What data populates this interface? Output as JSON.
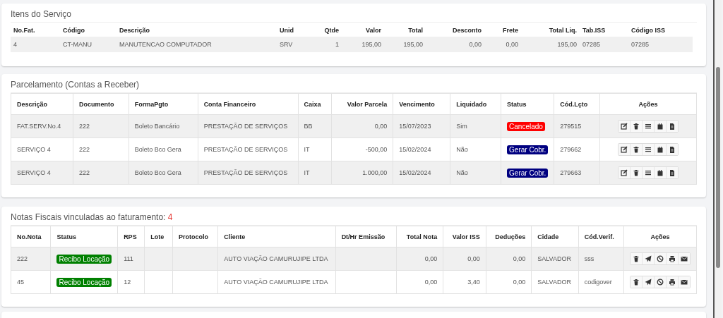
{
  "items_section": {
    "title": "Itens do Serviço",
    "columns": [
      "No.Fat.",
      "Código",
      "Descrição",
      "Unid",
      "Qtde",
      "Valor",
      "Total",
      "Desconto",
      "Frete",
      "Total Liq.",
      "Tab.ISS",
      "Código ISS"
    ],
    "rows": [
      [
        "4",
        "CT-MANU",
        "MANUTENCAO COMPUTADOR",
        "SRV",
        "1",
        "195,00",
        "195,00",
        "0,00",
        "0,00",
        "195,00",
        "07285",
        "07285"
      ]
    ]
  },
  "installments": {
    "title": "Parcelamento (Contas a Receber)",
    "columns": [
      "Descrição",
      "Documento",
      "FormaPgto",
      "Conta Financeiro",
      "Caixa",
      "Valor Parcela",
      "Vencimento",
      "Liquidado",
      "Status",
      "Cód.Lçto",
      "Ações"
    ],
    "rows": [
      [
        "FAT.SERV.No.4",
        "222",
        "Boleto Bancário",
        "PRESTAÇÃO DE SERVIÇOS",
        "BB",
        "0,00",
        "15/07/2023",
        "Sim",
        {
          "label": "Cancelado",
          "color": "#ff0000"
        },
        "279515"
      ],
      [
        "SERVIÇO 4",
        "222",
        "Boleto Bco Gera",
        "PRESTAÇÃO DE SERVIÇOS",
        "IT",
        "-500,00",
        "15/02/2024",
        "Não",
        {
          "label": "Gerar Cobr.",
          "color": "#000080"
        },
        "279662"
      ],
      [
        "SERVIÇO 4",
        "222",
        "Boleto Bco Gera",
        "PRESTAÇÃO DE SERVIÇOS",
        "IT",
        "1.000,00",
        "15/02/2024",
        "Não",
        {
          "label": "Gerar Cobr.",
          "color": "#000080"
        },
        "279663"
      ]
    ]
  },
  "invoices": {
    "title": "Notas Fiscais vinculadas ao faturamento:",
    "count": "4",
    "columns": [
      "No.Nota",
      "Status",
      "RPS",
      "Lote",
      "Protocolo",
      "Cliente",
      "Dt/Hr Emissão",
      "Total Nota",
      "Valor ISS",
      "Deduções",
      "Cidade",
      "Cód.Verif.",
      "Ações"
    ],
    "rows": [
      [
        "222",
        {
          "label": "Recibo Locação",
          "color": "#008000"
        },
        "111",
        "",
        "",
        "AUTO VIAÇÃO CAMURUJIPE LTDA",
        "",
        "0,00",
        "0,00",
        "0,00",
        "SALVADOR",
        "sss"
      ],
      [
        "45",
        {
          "label": "Recibo Locação",
          "color": "#008000"
        },
        "12",
        "",
        "",
        "AUTO VIAÇÃO CAMURUJIPE LTDA",
        "",
        "0,00",
        "3,40",
        "0,00",
        "SALVADOR",
        "codigover"
      ]
    ]
  }
}
